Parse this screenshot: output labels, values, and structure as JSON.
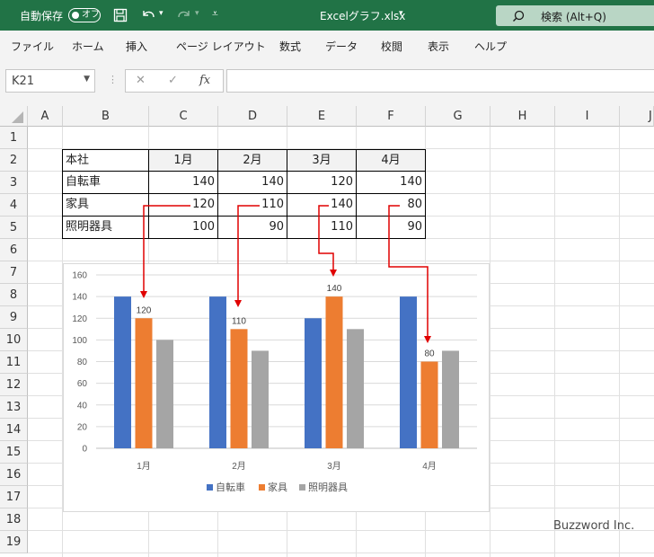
{
  "titlebar": {
    "autosave_label": "自動保存",
    "autosave_state": "オフ",
    "filename": "Excelグラフ.xlsx",
    "search_label": "検索 (Alt+Q)"
  },
  "menu": [
    "ファイル",
    "ホーム",
    "挿入",
    "ページ レイアウト",
    "数式",
    "データ",
    "校閲",
    "表示",
    "ヘルプ"
  ],
  "formula_bar": {
    "name_box": "K21",
    "fx": "fx",
    "value": ""
  },
  "columns": [
    "A",
    "B",
    "C",
    "D",
    "E",
    "F",
    "G",
    "H",
    "I",
    "J"
  ],
  "rows": [
    "1",
    "2",
    "3",
    "4",
    "5",
    "6",
    "7",
    "8",
    "9",
    "10",
    "11",
    "12",
    "13",
    "14",
    "15",
    "16",
    "17",
    "18",
    "19"
  ],
  "table": {
    "header": [
      "本社",
      "1月",
      "2月",
      "3月",
      "4月"
    ],
    "rows": [
      [
        "自転車",
        "140",
        "140",
        "120",
        "140"
      ],
      [
        "家具",
        "120",
        "110",
        "140",
        "80"
      ],
      [
        "照明器具",
        "100",
        "90",
        "110",
        "90"
      ]
    ]
  },
  "chart_data": {
    "type": "bar",
    "categories": [
      "1月",
      "2月",
      "3月",
      "4月"
    ],
    "series": [
      {
        "name": "自転車",
        "values": [
          140,
          140,
          120,
          140
        ],
        "color": "#4472c4"
      },
      {
        "name": "家具",
        "values": [
          120,
          110,
          140,
          80
        ],
        "color": "#ed7d31",
        "data_labels": [
          "120",
          "110",
          "140",
          "80"
        ]
      },
      {
        "name": "照明器具",
        "values": [
          100,
          90,
          110,
          90
        ],
        "color": "#a5a5a5"
      }
    ],
    "ylim": [
      0,
      160
    ],
    "yticks": [
      "0",
      "20",
      "40",
      "60",
      "80",
      "100",
      "120",
      "140",
      "160"
    ],
    "grid": true,
    "legend": "bottom",
    "annotation_color": "#e00000"
  },
  "watermark": "Buzzword Inc."
}
